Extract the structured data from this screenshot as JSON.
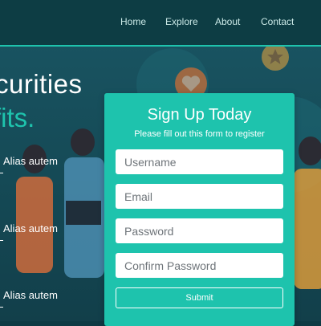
{
  "nav": {
    "items": [
      {
        "label": "Home"
      },
      {
        "label": "Explore"
      },
      {
        "label": "About"
      },
      {
        "label": "Contact"
      }
    ]
  },
  "hero": {
    "headline_line1": "curities",
    "headline_line2": "fits.",
    "features": [
      {
        "text": "Alias autem"
      },
      {
        "text": "Alias autem"
      },
      {
        "text": "Alias autem"
      }
    ]
  },
  "signup": {
    "title": "Sign Up Today",
    "subtitle": "Please fill out this form to register",
    "fields": {
      "username": {
        "placeholder": "Username"
      },
      "email": {
        "placeholder": "Email"
      },
      "password": {
        "placeholder": "Password"
      },
      "confirm_password": {
        "placeholder": "Confirm Password"
      }
    },
    "submit_label": "Submit"
  },
  "colors": {
    "accent": "#1ec3ad",
    "nav_bg": "#0d3d44",
    "hero_bg": "#154a56"
  },
  "icons": [
    "star-icon",
    "heart-icon"
  ]
}
